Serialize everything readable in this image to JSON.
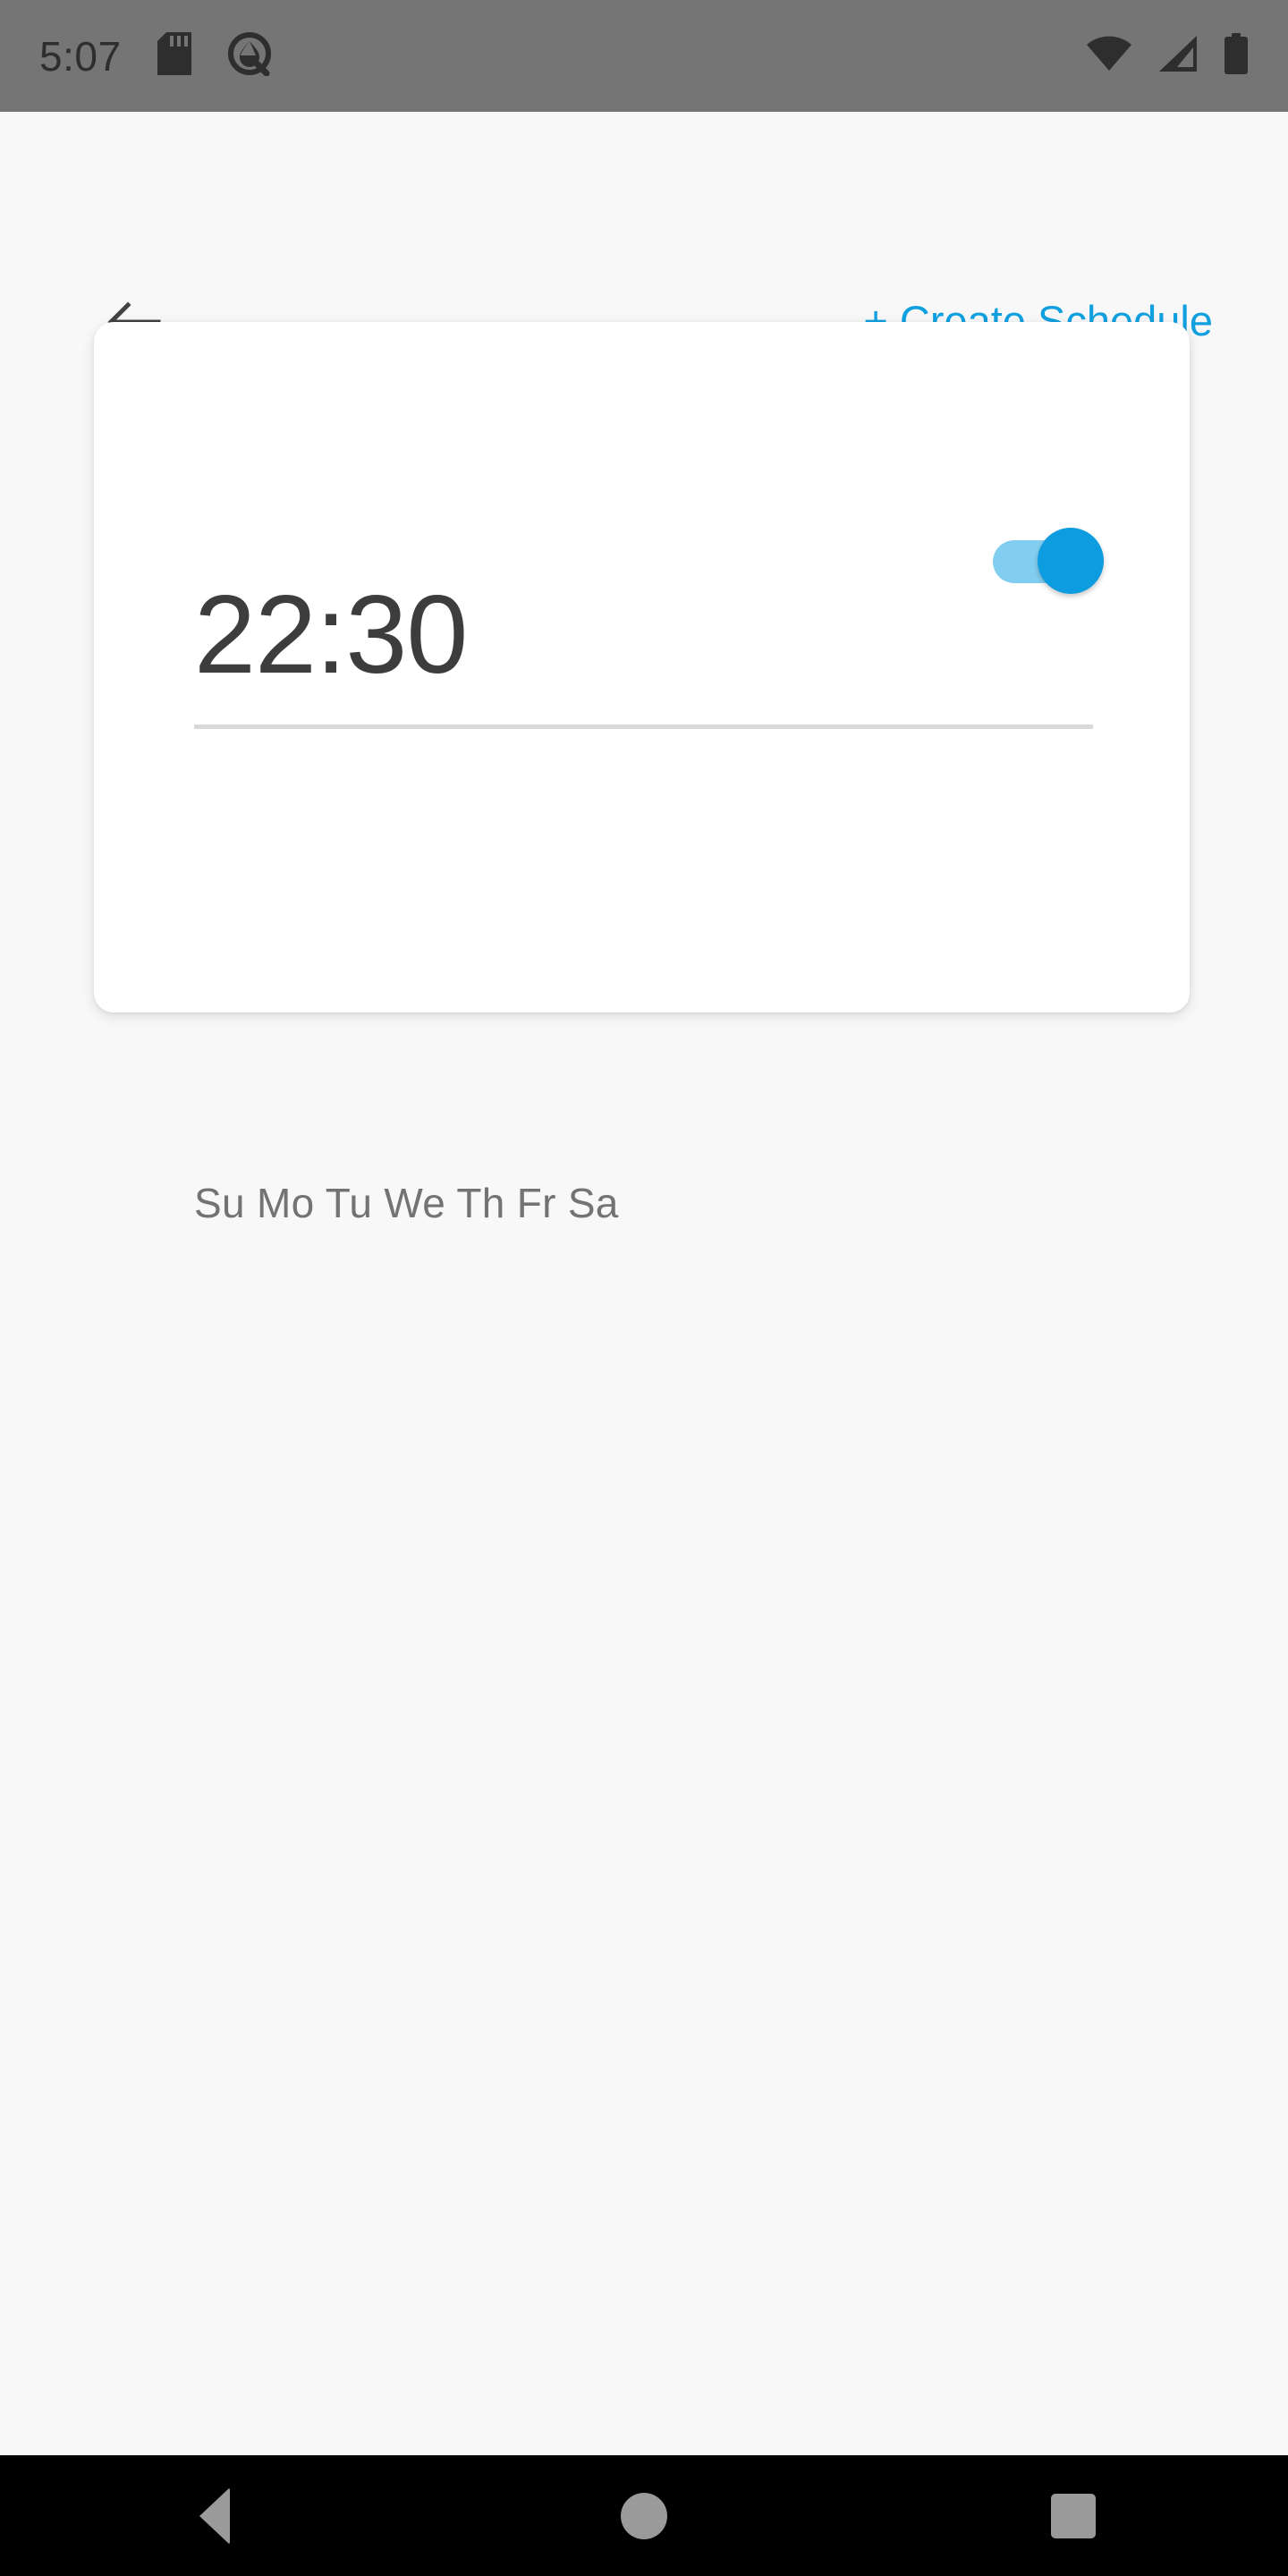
{
  "status_bar": {
    "time": "5:07",
    "background_color": "#757575",
    "icon_color": "#2e2e2e",
    "left_icons": [
      "sd-card-icon",
      "android-q-debug-icon"
    ],
    "right_icons": [
      "wifi-icon",
      "cellular-signal-icon",
      "battery-icon"
    ]
  },
  "app_bar": {
    "back_icon": "arrow-left-icon",
    "create_schedule_label": "+ Create Schedule",
    "accent_color": "#10a0e0"
  },
  "schedule_card": {
    "time": "22:30",
    "time_color": "#3d3d3d",
    "enabled": true,
    "toggle": {
      "state": "on",
      "track_color": "#82cef0",
      "thumb_color": "#0d9ce0"
    },
    "days_label": "Su Mo Tu We Th Fr Sa",
    "days_color": "#737373",
    "days": [
      "Su",
      "Mo",
      "Tu",
      "We",
      "Th",
      "Fr",
      "Sa"
    ],
    "divider_color": "#d9d9d9",
    "card_background": "#ffffff"
  },
  "page": {
    "background_color": "#f8f8f8"
  },
  "nav_bar": {
    "background_color": "#000000",
    "icon_color": "#9a9a9a",
    "buttons": [
      {
        "name": "back",
        "icon": "triangle-left-icon"
      },
      {
        "name": "home",
        "icon": "circle-icon"
      },
      {
        "name": "recents",
        "icon": "square-icon"
      }
    ]
  }
}
